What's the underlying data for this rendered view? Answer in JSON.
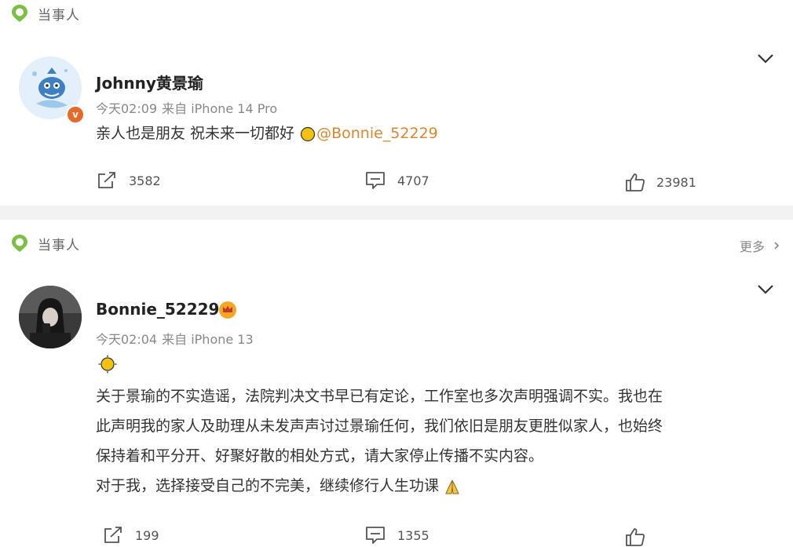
{
  "posts": [
    {
      "tag_label": "当事人",
      "username": "Johnny黄景瑜",
      "time": "今天02:09",
      "source": "来自 iPhone 14 Pro",
      "text": "亲人也是朋友 祝未来一切都好",
      "mention": "@Bonnie_52229",
      "verified_badge": "v",
      "actions": {
        "repost": "3582",
        "comment": "4707",
        "like": "23981"
      }
    },
    {
      "tag_label": "当事人",
      "more_label": "更多",
      "username": "Bonnie_52229",
      "time": "今天02:04",
      "source": "来自 iPhone 13",
      "lines": [
        "关于景瑜的不实造谣，法院判决文书早已有定论，工作室也多次声明强调不实。我也在",
        "此声明我的家人及助理从未发声声讨过景瑜任何，我们依旧是朋友更胜似家人，也始终",
        "保持着和平分开、好聚好散的相处方式，请大家停止传播不实内容。",
        "对于我，选择接受自己的不完美，继续修行人生功课"
      ],
      "actions": {
        "repost": "199",
        "comment": "1355"
      }
    }
  ],
  "icons": {
    "tag": "green-location-pin-icon",
    "collapse": "chevron-down-icon",
    "more": "chevron-right-icon",
    "repost": "share-icon",
    "comment": "comment-icon",
    "like": "thumbs-up-icon",
    "sun": "sun-emoji-icon",
    "pray": "praying-hands-emoji-icon",
    "member": "vip-crown-icon"
  },
  "colors": {
    "accent": "#e0852b",
    "tag_green": "#7ac143",
    "gap": "#f2f2f2",
    "badge": "#e8682a"
  }
}
